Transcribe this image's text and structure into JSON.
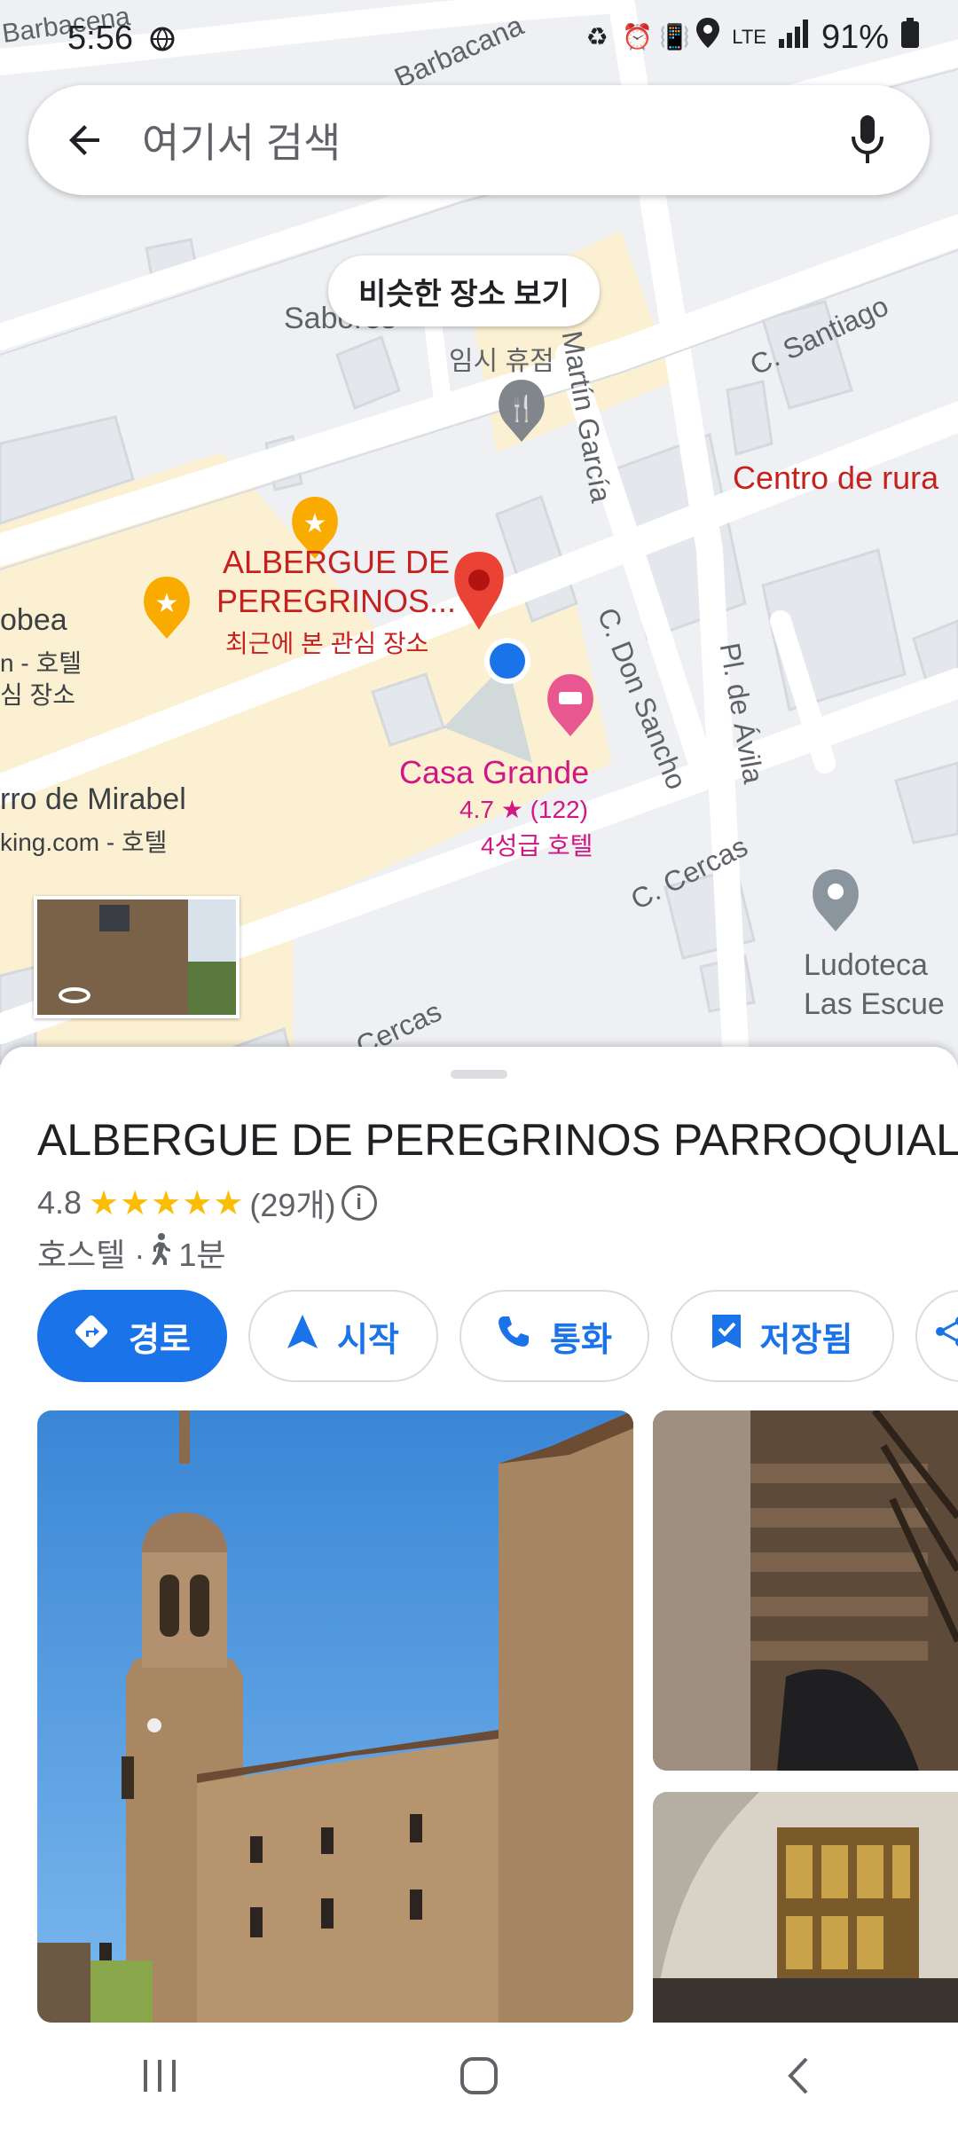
{
  "status_bar": {
    "time": "5:56",
    "network": "LTE",
    "battery": "91%"
  },
  "search": {
    "placeholder": "여기서 검색"
  },
  "map": {
    "similar_button": "비슷한 장소 보기",
    "labels": {
      "top_left_street": "Barbacena",
      "top_street": "Barbacana",
      "c_martin_garcia": "C. Martín García",
      "c_santiago": "C. Santiago",
      "centro_rural": "Centro de rura",
      "sabores": "Sabores",
      "restaurant_status": "임시 휴점",
      "albergue_name_line1": "ALBERGUE DE",
      "albergue_name_line2": "PEREGRINOS...",
      "albergue_sub": "최근에 본 관심 장소",
      "left_poi_name": "obea",
      "left_poi_type": "n - 호텔",
      "left_poi_sub": "심 장소",
      "mirabel_name": "rro de Mirabel",
      "mirabel_sub": "king.com - 호텔",
      "casa_grande_name": "Casa Grande",
      "casa_grande_rating": "4.7 ★ (122)",
      "casa_grande_type": "4성급 호텔",
      "c_don_sancho": "C. Don Sancho",
      "pl_de_avila": "Pl. de Ávila",
      "c_cercas_right": "C. Cercas",
      "c_cercas_bottom": "C. Cercas",
      "ludoteca_line1": "Ludoteca",
      "ludoteca_line2": "Las Escue"
    }
  },
  "place": {
    "title": "ALBERGUE DE PEREGRINOS PARROQUIAL",
    "rating": "4.8",
    "stars": "★★★★★",
    "review_count": "(29개)",
    "info_icon_label": "i",
    "type": "호스텔 · ",
    "walk_time": "1분"
  },
  "actions": [
    {
      "label": "경로",
      "icon": "directions-icon"
    },
    {
      "label": "시작",
      "icon": "navigation-icon"
    },
    {
      "label": "통화",
      "icon": "phone-icon"
    },
    {
      "label": "저장됨",
      "icon": "bookmark-icon"
    }
  ],
  "colors": {
    "accent": "#1a73e8",
    "marker_red": "#ea4335",
    "hotel_pink": "#d01884",
    "star_yellow": "#fbbc04"
  }
}
